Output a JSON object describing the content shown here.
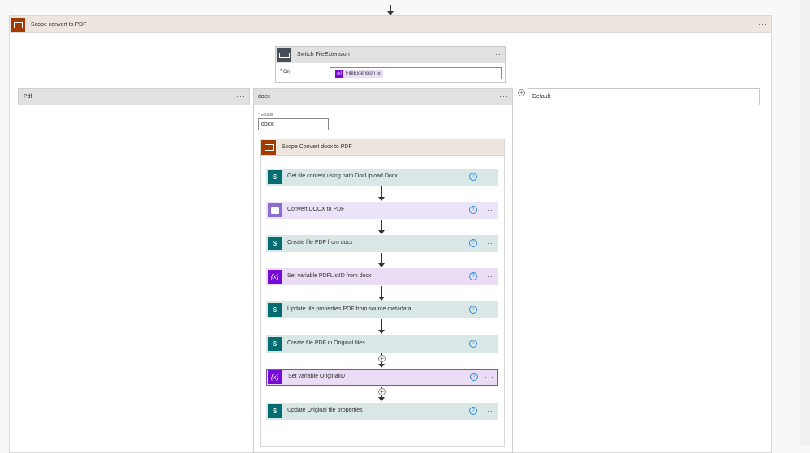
{
  "colors": {
    "sharepoint": "#036c70",
    "variable": "#770bd6",
    "converter": "#8c6cd0",
    "scope_header": "#efe5df",
    "scope_icon": "#a33b00",
    "sp_row": "#d9e7e6",
    "var_row": "#eadcf5",
    "conv_row": "#ebe3f7"
  },
  "outer_scope": {
    "title": "Scope convert to PDF",
    "icon": "scope-icon"
  },
  "switch": {
    "title": "Switch FileExtension",
    "on_label": "On",
    "token": "FileExtension",
    "icon": "switch-icon"
  },
  "cases": {
    "pdf": {
      "title": "Pdf"
    },
    "docx": {
      "title": "docx",
      "equals_label": "Equals",
      "equals_value": "docx"
    },
    "default": {
      "title": "Default"
    }
  },
  "inner_scope": {
    "title": "Scope Convert docx to PDF",
    "icon": "scope-icon"
  },
  "actions": [
    {
      "label": "Get file content using path DocUpload Docx",
      "icon": "sharepoint-icon"
    },
    {
      "label": "Convert DOCX to PDF",
      "icon": "converter-icon"
    },
    {
      "label": "Create file PDF from docx",
      "icon": "sharepoint-icon"
    },
    {
      "label": "Set variable PDFListID from docx",
      "icon": "variable-icon"
    },
    {
      "label": "Update file properties PDF from source metadata",
      "icon": "sharepoint-icon"
    },
    {
      "label": "Create file PDF in Original files",
      "icon": "sharepoint-icon"
    },
    {
      "label": "Set variable OriginalID",
      "icon": "variable-icon"
    },
    {
      "label": "Update Original file properties",
      "icon": "sharepoint-icon"
    }
  ],
  "glyphs": {
    "more": "···",
    "help": "?",
    "plus": "+",
    "remove": "×",
    "variable": "{x}",
    "sharepoint": "S"
  }
}
